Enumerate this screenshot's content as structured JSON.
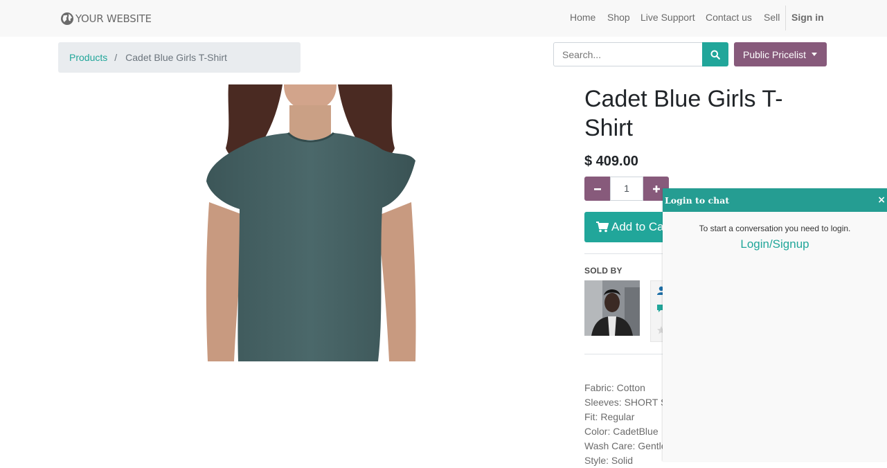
{
  "nav": {
    "logo_text": "YOUR WEBSITE",
    "items": [
      "Home",
      "Shop",
      "Live Support",
      "Contact us",
      "Sell"
    ],
    "signin": "Sign in"
  },
  "breadcrumb": {
    "link": "Products",
    "separator": "/",
    "current": "Cadet Blue Girls T-Shirt"
  },
  "search": {
    "placeholder": "Search..."
  },
  "pricelist": {
    "label": "Public Pricelist"
  },
  "product": {
    "title": "Cadet Blue Girls T-Shirt",
    "price": "$ 409.00",
    "quantity": "1",
    "add_to_cart": "Add to Cart",
    "sold_by_label": "SOLD BY",
    "attributes": [
      "Fabric: Cotton",
      "Sleeves: SHORT SLEEVES",
      "Fit: Regular",
      "Color: CadetBlue",
      "Wash Care: Gentle",
      "Style: Solid"
    ]
  },
  "chat": {
    "header": "Login to chat",
    "close": "×",
    "message": "To start a conversation you need to login.",
    "link": "Login/Signup"
  },
  "colors": {
    "primary": "#21a69a",
    "secondary": "#875a7b",
    "chat_header": "#259d92"
  }
}
